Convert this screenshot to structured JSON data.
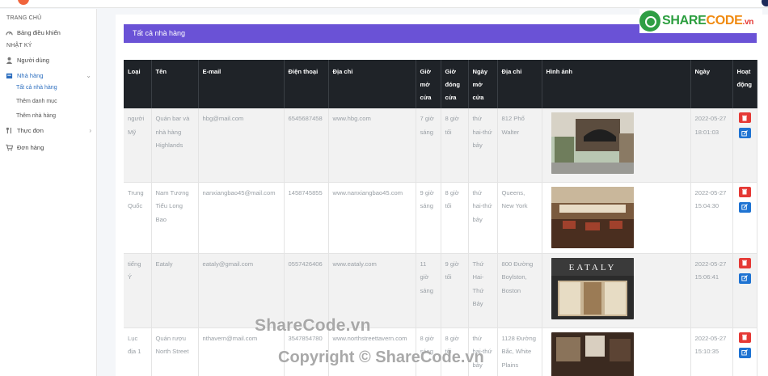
{
  "sidebar": {
    "sections": [
      "TRANG CHỦ",
      "NHẬT KÝ"
    ],
    "dashboard": "Bảng điều khiển",
    "users": "Người dùng",
    "restaurants": "Nhà hàng",
    "sub": [
      "Tất cả nhà hàng",
      "Thêm danh mục",
      "Thêm nhà hàng"
    ],
    "menu": "Thực đơn",
    "orders": "Đơn hàng"
  },
  "page": {
    "title": "Tất cả nhà hàng"
  },
  "brand": {
    "main": "SHARE",
    "accent": "CODE",
    "tld": ".vn"
  },
  "table": {
    "headers": [
      "Loại",
      "Tên",
      "E-mail",
      "Điện thoại",
      "Địa chỉ",
      "Giờ mở cửa",
      "Giờ đóng cửa",
      "Ngày mở cửa",
      "Địa chỉ",
      "Hình ảnh",
      "Ngày",
      "Hoạt động"
    ],
    "rows": [
      [
        "người Mỹ",
        "Quán bar và nhà hàng Highlands",
        "hbg@mail.com",
        "6545687458",
        "www.hbg.com",
        "7 giờ sáng",
        "8 giờ tối",
        "thứ hai-thứ bảy",
        "812 Phố Walter",
        "",
        "2022-05-27 18:01:03"
      ],
      [
        "Trung Quốc",
        "Nam Tương Tiểu Long Bao",
        "nanxiangbao45@mail.com",
        "1458745855",
        "www.nanxiangbao45.com",
        "9 giờ sáng",
        "8 giờ tối",
        "thứ hai-thứ bảy",
        "Queens, New York",
        "",
        "2022-05-27 15:04:30"
      ],
      [
        "tiếng Ý",
        "Eataly",
        "eataly@gmail.com",
        "0557426406",
        "www.eataly.com",
        "11 giờ sáng",
        "9 giờ tối",
        "Thứ Hai-Thứ Bảy",
        "800 Đường Boylston, Boston",
        "EATALY",
        "2022-05-27 15:06:41"
      ],
      [
        "Lục địa 1",
        "Quán rượu North Street",
        "nthavern@mail.com",
        "3547854780",
        "www.northstreettavern.com",
        "8 giờ sáng",
        "8 giờ tối",
        "thứ hai-thứ bảy",
        "1128 Đường Bắc, White Plains",
        "",
        "2022-05-27 15:10:35"
      ]
    ]
  },
  "watermark": {
    "line1": "ShareCode.vn",
    "line2": "Copyright © ShareCode.vn"
  },
  "colors": {
    "header": "#6a52d6",
    "delete": "#e53935",
    "edit": "#1e73d2",
    "sidebar_active": "#2c6ebf"
  }
}
